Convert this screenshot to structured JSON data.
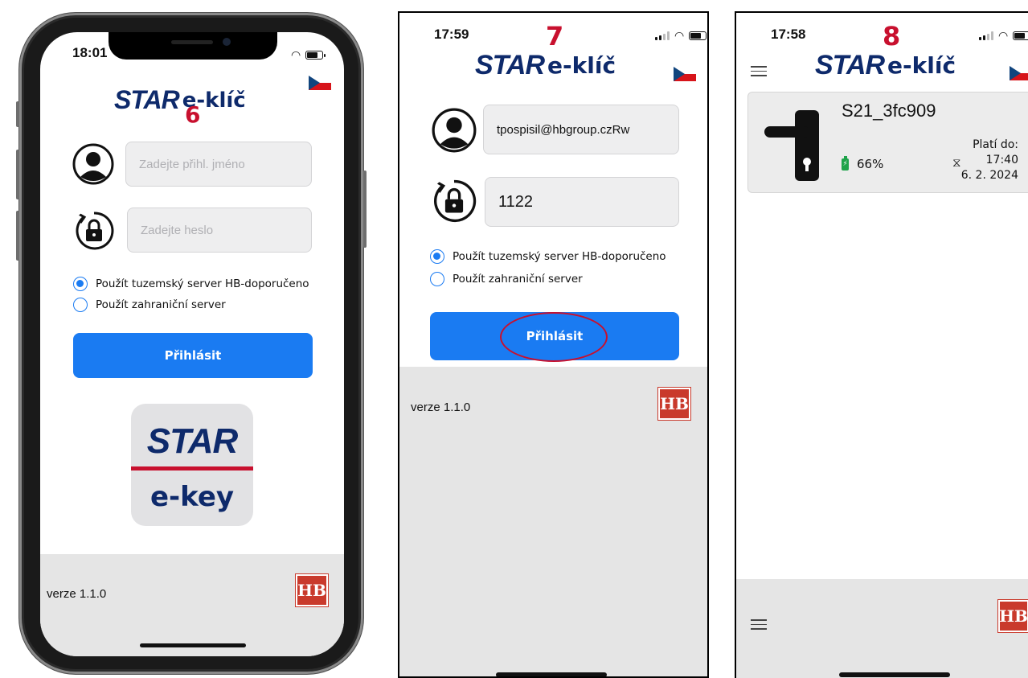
{
  "brand": {
    "star": "STAR",
    "ekey": "e-klíč",
    "tile_star": "STAR",
    "tile_ekey": "e-key",
    "hb": "HB"
  },
  "colors": {
    "accent": "#1a7bf2",
    "brand_navy": "#0e2a6b",
    "step_red": "#c8102e",
    "battery_green": "#1fa34a",
    "hb_red": "#c93a2c"
  },
  "screens": [
    {
      "step": "6",
      "time": "18:01",
      "username_placeholder": "Zadejte přihl. jméno",
      "password_placeholder": "Zadejte heslo",
      "radio_domestic": "Použít tuzemský server HB-doporučeno",
      "radio_foreign": "Použít zahraniční server",
      "login_label": "Přihlásit",
      "version": "verze  1.1.0"
    },
    {
      "step": "7",
      "time": "17:59",
      "username_value": "tpospisil@hbgroup.czRw",
      "password_value": "1122",
      "radio_domestic": "Použít tuzemský server HB-doporučeno",
      "radio_foreign": "Použít zahraniční server",
      "login_label": "Přihlásit",
      "version": "verze  1.1.0"
    },
    {
      "step": "8",
      "time": "17:58",
      "lock": {
        "name": "S21_3fc909",
        "battery": "66%",
        "valid_label": "Platí do:",
        "valid_time": "17:40",
        "valid_date": "6. 2. 2024"
      }
    }
  ],
  "icons": [
    "user-icon",
    "lock-refresh-icon",
    "flag-cz-icon",
    "hamburger-icon",
    "door-handle-icon",
    "battery-icon",
    "hourglass-icon",
    "hb-logo-icon"
  ]
}
